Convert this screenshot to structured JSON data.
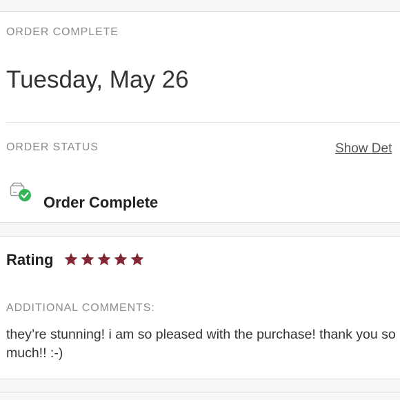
{
  "order": {
    "section_title": "ORDER COMPLETE",
    "date": "Tuesday, May 26",
    "status_title": "ORDER STATUS",
    "show_details_label": "Show Det",
    "status_icon": "package-check-icon",
    "status_text": "Order Complete"
  },
  "review": {
    "rating_label": "Rating",
    "rating": 5,
    "rating_max": 5,
    "star_color": "#862736",
    "comments_title": "ADDITIONAL COMMENTS:",
    "comment": "they’re stunning! i am so pleased with the purchase! thank you so much!! :-)"
  },
  "colors": {
    "status_check_green": "#36b558"
  }
}
